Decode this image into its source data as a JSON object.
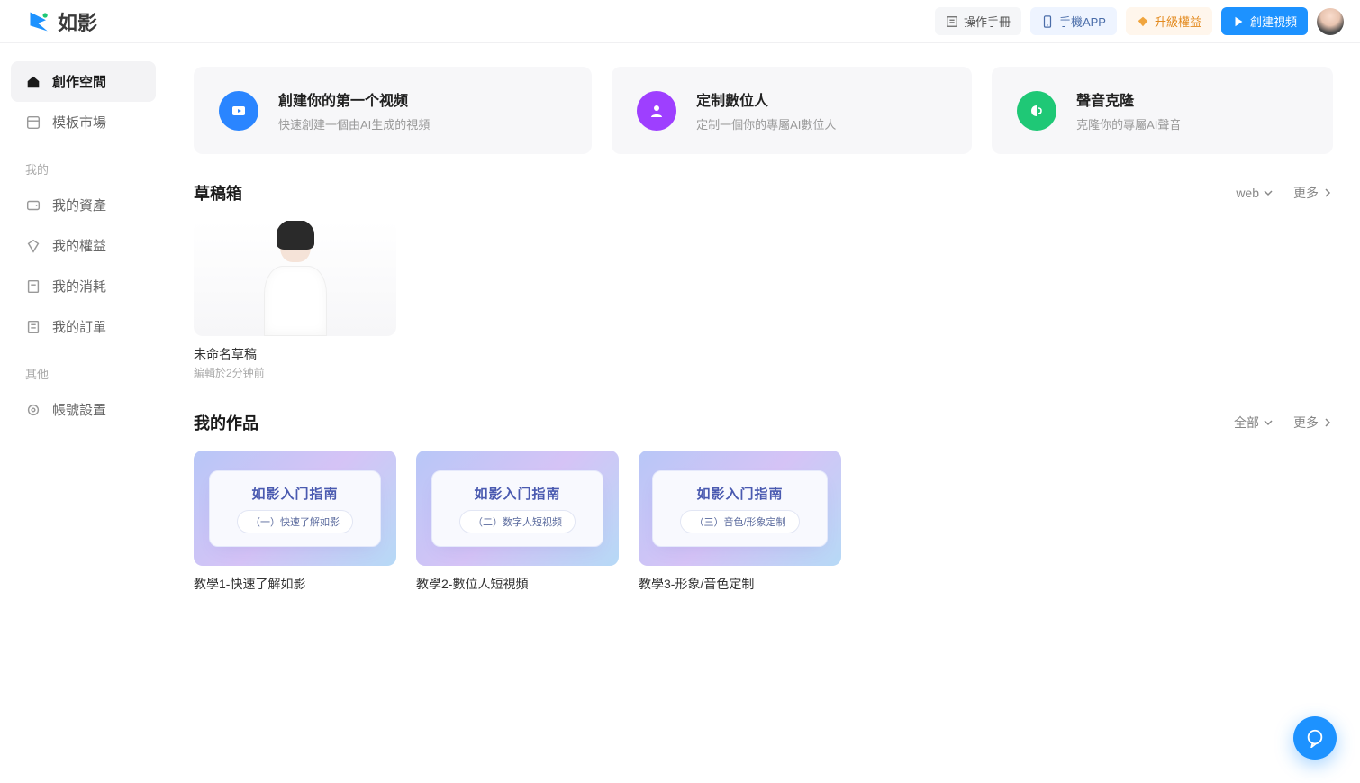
{
  "brand": "如影",
  "header": {
    "manual": "操作手冊",
    "app": "手機APP",
    "upgrade": "升級權益",
    "create": "創建視頻"
  },
  "sidebar": {
    "main": [
      {
        "label": "創作空間",
        "active": true
      },
      {
        "label": "模板市場",
        "active": false
      }
    ],
    "mine_label": "我的",
    "mine": [
      {
        "label": "我的資產"
      },
      {
        "label": "我的權益"
      },
      {
        "label": "我的消耗"
      },
      {
        "label": "我的訂單"
      }
    ],
    "other_label": "其他",
    "other": [
      {
        "label": "帳號設置"
      }
    ]
  },
  "cards": [
    {
      "title": "創建你的第一个视频",
      "desc": "快速創建一個由AI生成的視頻",
      "icon": "video",
      "color": "blue"
    },
    {
      "title": "定制數位人",
      "desc": "定制一個你的專屬AI數位人",
      "icon": "person",
      "color": "purple"
    },
    {
      "title": "聲音克隆",
      "desc": "克隆你的專屬AI聲音",
      "icon": "voice",
      "color": "green"
    }
  ],
  "drafts": {
    "heading": "草稿箱",
    "filter": "web",
    "more": "更多",
    "items": [
      {
        "title": "未命名草稿",
        "meta": "編輯於2分钟前"
      }
    ]
  },
  "works": {
    "heading": "我的作品",
    "filter": "全部",
    "more": "更多",
    "guide_title": "如影入门指南",
    "items": [
      {
        "subtitle": "（一）快速了解如影",
        "title": "教學1-快速了解如影"
      },
      {
        "subtitle": "（二）数字人短视频",
        "title": "教學2-數位人短視頻"
      },
      {
        "subtitle": "（三）音色/形象定制",
        "title": "教學3-形象/音色定制"
      }
    ]
  }
}
